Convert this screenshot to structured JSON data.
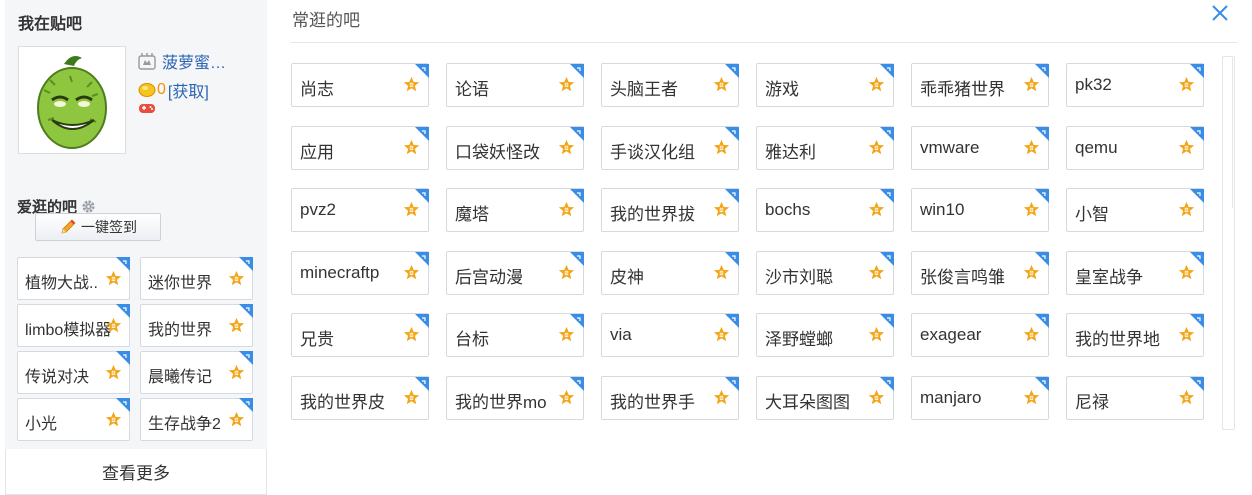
{
  "sidebar": {
    "title": "我在贴吧",
    "username": "菠萝蜜…",
    "tbean_count": "0",
    "tbean_get": "[获取]",
    "fav_title": "爱逛的吧",
    "sign_button": "一键签到",
    "tags": [
      "植物大战..",
      "迷你世界",
      "limbo模拟器",
      "我的世界",
      "传说对决",
      "晨曦传记",
      "小光",
      "生存战争2"
    ],
    "more": "查看更多"
  },
  "panel": {
    "title": "常逛的吧",
    "tags": [
      "尚志",
      "论语",
      "头脑王者",
      "游戏",
      "乖乖猪世界",
      "pk32",
      "应用",
      "口袋妖怪改",
      "手谈汉化组",
      "雅达利",
      "vmware",
      "qemu",
      "pvz2",
      "魔塔",
      "我的世界拔",
      "bochs",
      "win10",
      "小智",
      "minecraftp",
      "后宫动漫",
      "皮神",
      "沙市刘聪",
      "张俊言鸣雏",
      "皇室战争",
      "兄贵",
      "台标",
      "via",
      "泽野螳螂",
      "exagear",
      "我的世界地",
      "我的世界皮",
      "我的世界mo",
      "我的世界手",
      "大耳朵图图",
      "manjaro",
      "尼禄"
    ]
  },
  "colors": {
    "link": "#2d64b3",
    "level_star": "#f2a516",
    "corner_blue": "#3a8de6"
  }
}
